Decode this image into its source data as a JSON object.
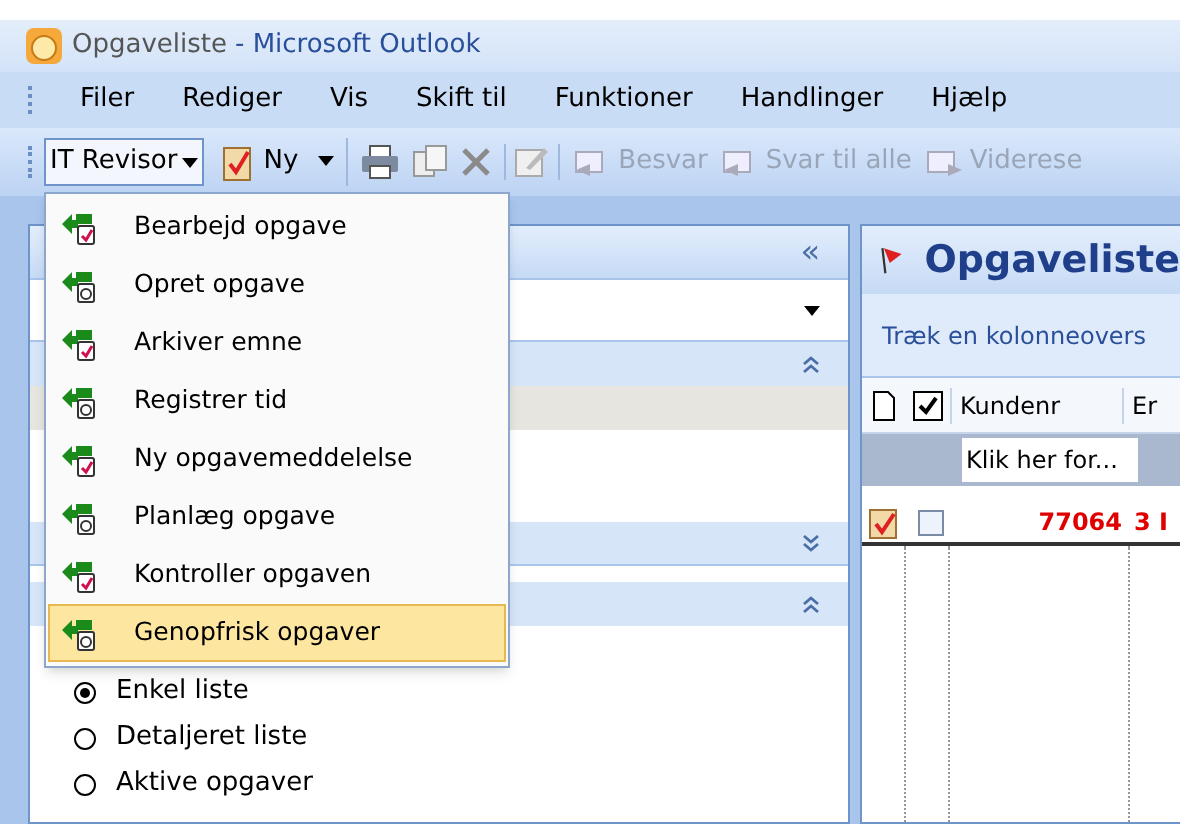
{
  "window": {
    "title": "Opgaveliste",
    "app": "- Microsoft Outlook"
  },
  "menu_bar": [
    "Filer",
    "Rediger",
    "Vis",
    "Skift til",
    "Funktioner",
    "Handlinger",
    "Hjælp"
  ],
  "toolbar": [
    {
      "kind": "dropdown",
      "label": "IT Revisor",
      "selected": true
    },
    {
      "kind": "new",
      "label": "Ny"
    },
    {
      "kind": "print"
    },
    {
      "kind": "copy"
    },
    {
      "kind": "delete"
    },
    {
      "kind": "edit"
    },
    {
      "kind": "reply",
      "label": "Besvar",
      "disabled": true
    },
    {
      "kind": "replyall",
      "label": "Svar til alle",
      "disabled": true
    },
    {
      "kind": "forward",
      "label": "Viderese",
      "disabled": true
    }
  ],
  "dropdown_menu": [
    {
      "label": "Bearbejd opgave",
      "selected": false
    },
    {
      "label": "Opret opgave",
      "selected": false
    },
    {
      "label": "Arkiver emne",
      "selected": false
    },
    {
      "label": "Registrer tid",
      "selected": false
    },
    {
      "label": "Ny opgavemeddelelse",
      "selected": false
    },
    {
      "label": "Planlæg opgave",
      "selected": false
    },
    {
      "label": "Kontroller opgaven",
      "selected": false
    },
    {
      "label": "Genopfrisk opgaver",
      "selected": true
    }
  ],
  "navigation_pane": {
    "collapse": "«",
    "views": [
      {
        "label": "Enkel liste",
        "selected": true
      },
      {
        "label": "Detaljeret liste",
        "selected": false
      },
      {
        "label": "Aktive opgaver",
        "selected": false
      }
    ]
  },
  "task_list": {
    "title": "Opgaveliste",
    "group_hint": "Træk en kolonneovers",
    "columns": [
      "Kundenr",
      "Er"
    ],
    "filter_placeholder": "Klik her for...",
    "rows": [
      {
        "checked": false,
        "cells": [
          "77064",
          "3 I"
        ]
      }
    ]
  }
}
